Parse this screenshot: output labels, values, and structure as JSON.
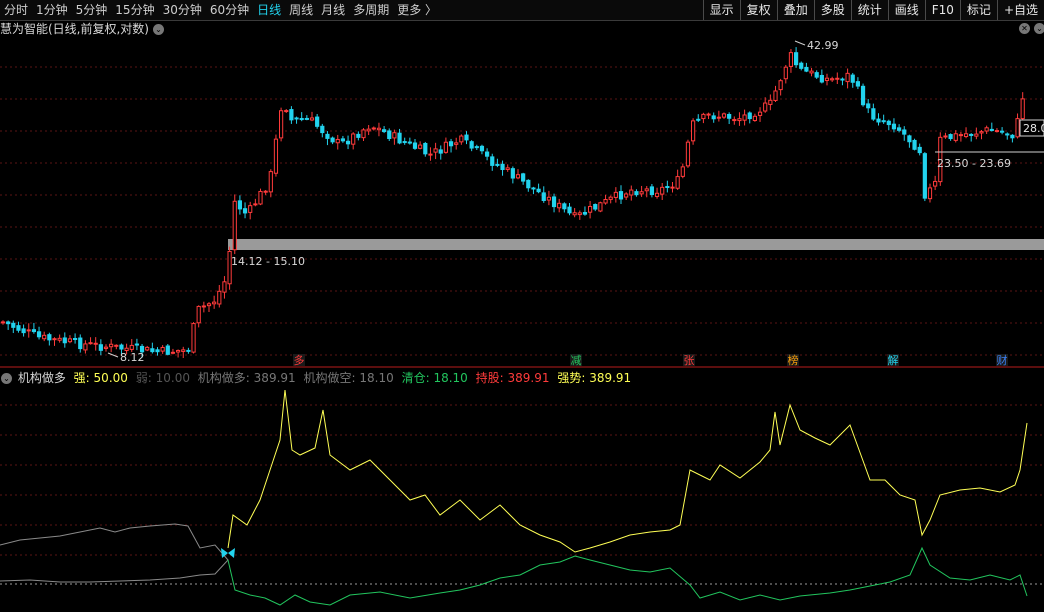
{
  "toolbar": {
    "tabs": [
      "分时",
      "1分钟",
      "5分钟",
      "15分钟",
      "30分钟",
      "60分钟",
      "日线",
      "周线",
      "月线",
      "多周期",
      "更多"
    ],
    "active_tab": "日线",
    "more_arrow": "〉",
    "right_buttons": [
      "显示",
      "复权",
      "叠加",
      "多股",
      "统计",
      "画线",
      "F10",
      "标记",
      "+自选"
    ]
  },
  "title": {
    "text": "慧为智能(日线,前复权,对数)",
    "dropdown_glyph": "⌄",
    "close_glyph": "✕",
    "right_glyph": "⌄"
  },
  "price_labels": {
    "high": "42.99",
    "low": "8.12",
    "gap_upper": "23.50 - 23.69",
    "gap_lower": "14.12 - 15.10",
    "current": "28.0"
  },
  "events": [
    {
      "label": "多",
      "color": "#ff3b3b"
    },
    {
      "label": "减",
      "color": "#22c55e"
    },
    {
      "label": "张",
      "color": "#ff3b3b"
    },
    {
      "label": "榜",
      "color": "#f59e0b"
    },
    {
      "label": "解",
      "color": "#22d3ee"
    },
    {
      "label": "财",
      "color": "#3b82f6"
    }
  ],
  "indicator": {
    "name": "机构做多",
    "strong_label": "强:",
    "strong_value": "50.00",
    "weak_label": "弱:",
    "weak_value": "10.00",
    "long_label": "机构做多:",
    "long_value": "389.91",
    "short_label": "机构做空:",
    "short_value": "18.10",
    "clear_label": "清仓:",
    "clear_value": "18.10",
    "hold_label": "持股:",
    "hold_value": "389.91",
    "trend_label": "强势:",
    "trend_value": "389.91"
  },
  "colors": {
    "up": "#ff3b3b",
    "down": "#22d3ee",
    "yellow": "#ffff55",
    "green": "#22c55e",
    "gray": "#8a8a8a"
  }
}
